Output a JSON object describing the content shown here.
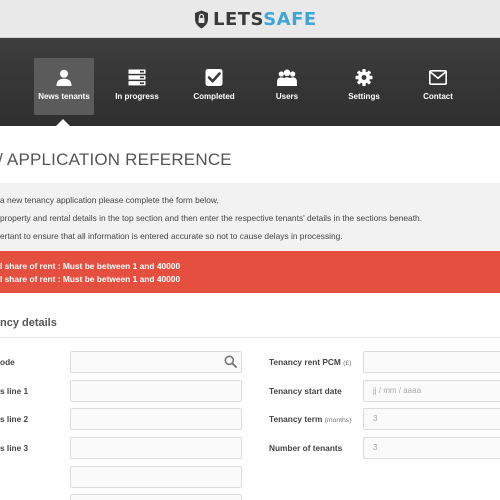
{
  "brand": {
    "name_part1": "LETS",
    "name_part2": "SAFE",
    "color_dark": "#3a3a3a",
    "color_accent": "#3fa5d6"
  },
  "nav": {
    "items": [
      {
        "label": "News tenants",
        "icon": "user-icon",
        "active": true
      },
      {
        "label": "In progress",
        "icon": "server-icon",
        "active": false
      },
      {
        "label": "Completed",
        "icon": "checkbox-icon",
        "active": false
      },
      {
        "label": "Users",
        "icon": "users-icon",
        "active": false
      },
      {
        "label": "Settings",
        "icon": "gear-icon",
        "active": false
      },
      {
        "label": "Contact",
        "icon": "envelope-icon",
        "active": false
      }
    ]
  },
  "page": {
    "title": "/ APPLICATION REFERENCE"
  },
  "intro": {
    "lines": [
      "a new tenancy application please complete the form below.",
      "property and rental details in the top section and then enter the respective tenants' details in the sections beneath.",
      "ertant to ensure that all information is entered accurate so not to cause delays in processing."
    ]
  },
  "alert": {
    "color": "#e54f3f",
    "lines": [
      "l share of rent : Must be between 1 and 40000",
      "l share of rent : Must be between 1 and 40000"
    ]
  },
  "tenancy": {
    "section_title": "ncy details",
    "left_fields": [
      {
        "label": "ode",
        "value": ""
      },
      {
        "label": "s line 1",
        "value": ""
      },
      {
        "label": "s line 2",
        "value": ""
      },
      {
        "label": "s line 3",
        "value": ""
      },
      {
        "label": "",
        "value": ""
      }
    ],
    "right_fields": [
      {
        "label": "Tenancy rent PCM",
        "unit": "(£)",
        "value": ""
      },
      {
        "label": "Tenancy start date",
        "unit": "",
        "value": "jj / mm / aaaa"
      },
      {
        "label": "Tenancy term",
        "unit": "(months)",
        "value": "3"
      },
      {
        "label": "Number of tenants",
        "unit": "",
        "value": "3"
      }
    ]
  }
}
